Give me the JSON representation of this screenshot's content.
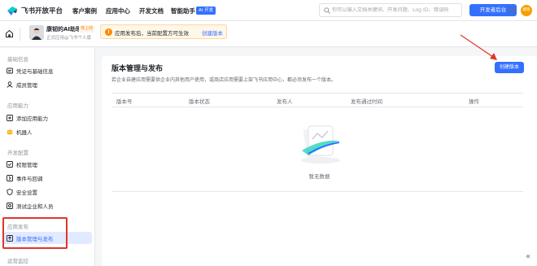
{
  "topbar": {
    "brand": "飞书开放平台",
    "nav": [
      "客户案例",
      "应用中心",
      "开发文档",
      "智能助手"
    ],
    "ai_badge": "AI 开发",
    "search_placeholder": "你可以输入文档关键词、开发问题、Log ID、错误码",
    "dev_console": "开发者后台",
    "user_avatar": "康铭",
    "accent": "#3370ff"
  },
  "subbar": {
    "app_name": "康韧的AI助理",
    "app_tag": "待上线",
    "app_sub": "正式应用@飞书个人版",
    "notice_text": "应用发布后，当前配置方可生效",
    "notice_link": "创建版本"
  },
  "sidebar": {
    "groups": [
      {
        "label": "基础信息",
        "items": [
          "凭证与基础信息",
          "成员管理"
        ]
      },
      {
        "label": "应用能力",
        "items": [
          "添加应用能力",
          "机器人"
        ]
      },
      {
        "label": "开发配置",
        "items": [
          "权限管理",
          "事件与回调",
          "安全设置",
          "测试企业和人员"
        ]
      },
      {
        "label": "应用发布",
        "items": [
          "版本管理与发布"
        ]
      },
      {
        "label": "运营监控",
        "items": []
      }
    ],
    "active_item": "版本管理与发布"
  },
  "main": {
    "title": "版本管理与发布",
    "description": "若企业自建应用需要供企业内其他用户使用，或商店应用需要上架飞书应用中心，都必须发布一个版本。",
    "create_button": "创建版本",
    "columns": [
      "版本号",
      "版本状态",
      "发布人",
      "发布通过时间",
      "操作"
    ],
    "rows": [],
    "empty_text": "暂无数据"
  },
  "icons": {
    "home": "home-icon",
    "search": "search-icon",
    "grid": "grid-icon",
    "collapse": "double-chevron-left-icon"
  }
}
